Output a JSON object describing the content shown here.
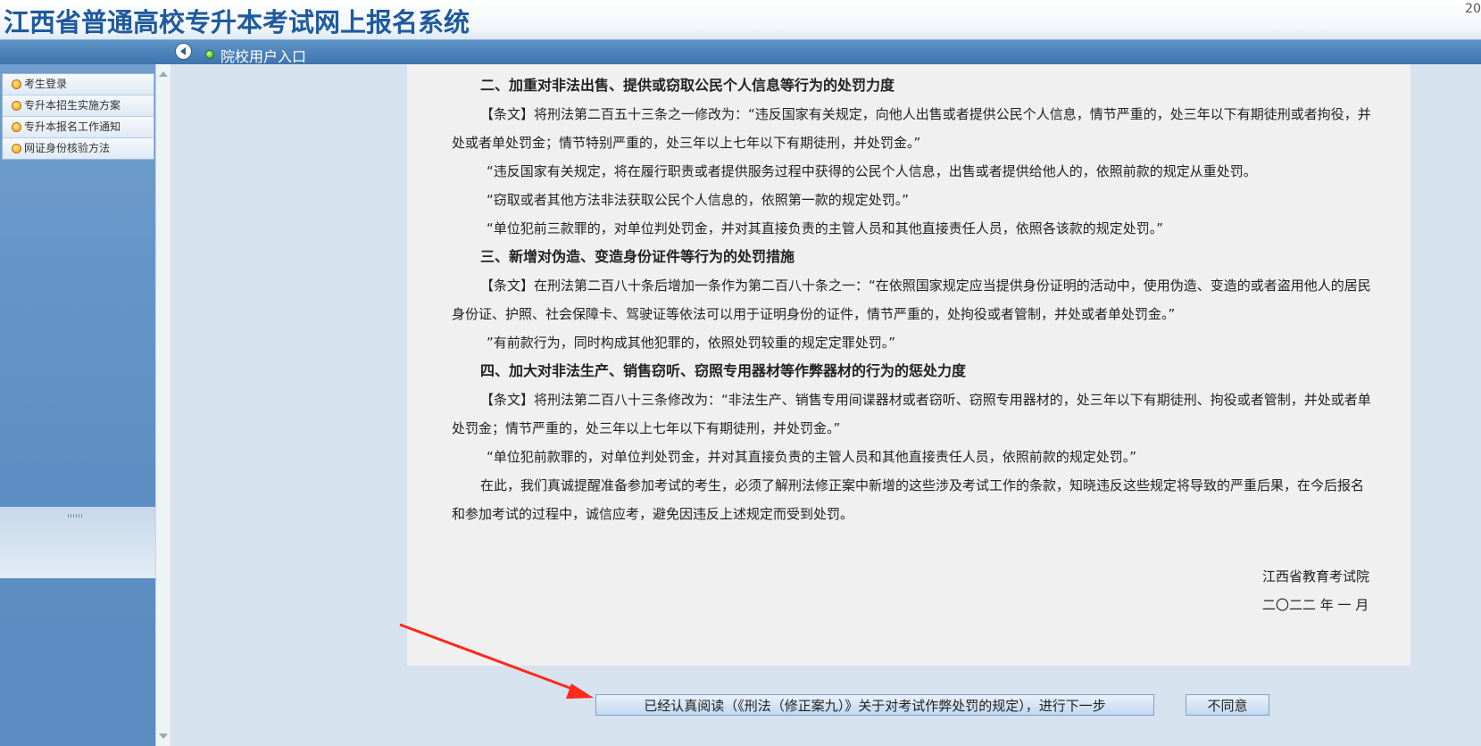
{
  "header": {
    "title": "江西省普通高校专升本考试网上报名系统",
    "corner_text": "20"
  },
  "navbar": {
    "entry_label": "院校用户入口"
  },
  "sidebar": {
    "items": [
      {
        "label": "考生登录"
      },
      {
        "label": "专升本招生实施方案"
      },
      {
        "label": "专升本报名工作通知"
      },
      {
        "label": "网证身份核验方法"
      }
    ]
  },
  "notice": {
    "section2": {
      "heading": "二、加重对非法出售、提供或窃取公民个人信息等行为的处罚力度",
      "p1": "【条文】将刑法第二百五十三条之一修改为：“违反国家有关规定，向他人出售或者提供公民个人信息，情节严重的，处三年以下有期徒刑或者拘役，并处或者单处罚金；情节特别严重的，处三年以上七年以下有期徒刑，并处罚金。”",
      "p2": "“违反国家有关规定，将在履行职责或者提供服务过程中获得的公民个人信息，出售或者提供给他人的，依照前款的规定从重处罚。",
      "p3": "“窃取或者其他方法非法获取公民个人信息的，依照第一款的规定处罚。”",
      "p4": "“单位犯前三款罪的，对单位判处罚金，并对其直接负责的主管人员和其他直接责任人员，依照各该款的规定处罚。”"
    },
    "section3": {
      "heading": "三、新增对伪造、变造身份证件等行为的处罚措施",
      "p1": "【条文】在刑法第二百八十条后增加一条作为第二百八十条之一：“在依照国家规定应当提供身份证明的活动中，使用伪造、变造的或者盗用他人的居民身份证、护照、社会保障卡、驾驶证等依法可以用于证明身份的证件，情节严重的，处拘役或者管制，并处或者单处罚金。”",
      "p2": "”有前款行为，同时构成其他犯罪的，依照处罚较重的规定定罪处罚。”"
    },
    "section4": {
      "heading": "四、加大对非法生产、销售窃听、窃照专用器材等作弊器材的行为的惩处力度",
      "p1": "【条文】将刑法第二百八十三条修改为：“非法生产、销售专用间谍器材或者窃听、窃照专用器材的，处三年以下有期徒刑、拘役或者管制，并处或者单处罚金；情节严重的，处三年以上七年以下有期徒刑，并处罚金。”",
      "p2": "“单位犯前款罪的，对单位判处罚金，并对其直接负责的主管人员和其他直接责任人员，依照前款的规定处罚。”"
    },
    "closing": "在此，我们真诚提醒准备参加考试的考生，必须了解刑法修正案中新增的这些涉及考试工作的条款，知晓违反这些规定将导致的严重后果，在今后报名和参加考试的过程中，诚信应考，避免因违反上述规定而受到处罚。",
    "signature": {
      "org": "江西省教育考试院",
      "date": "二〇二二 年 一 月"
    }
  },
  "actions": {
    "agree_label": "已经认真阅读（《刑法（修正案九）》关于对考试作弊处罚的规定），进行下一步",
    "disagree_label": "不同意"
  },
  "colors": {
    "title": "#1f5a9e",
    "navbar": "#4b82bb",
    "sidebar": "#5d8fc4",
    "panel": "#f0f0f0",
    "annotation_arrow": "#ff2a1a"
  }
}
